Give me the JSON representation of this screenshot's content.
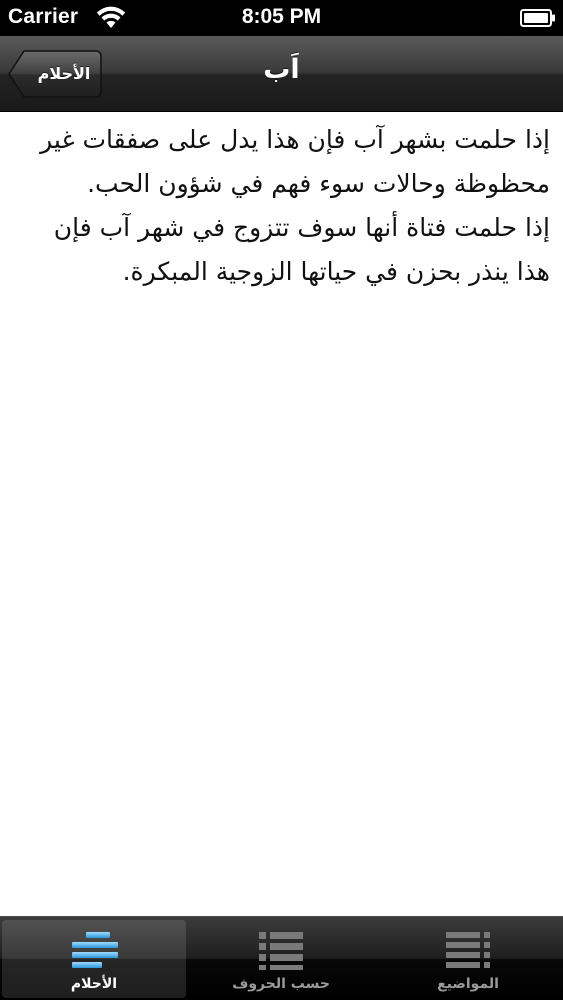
{
  "status_bar": {
    "carrier": "Carrier",
    "time": "8:05 PM",
    "wifi_icon": "wifi-icon",
    "battery_icon": "battery-icon"
  },
  "nav_bar": {
    "title": "اَب",
    "back_label": "الأحلام"
  },
  "content": {
    "paragraphs": [
      "إذا حلمت بشهر آب فإن هذا يدل على صفقات غير محظوظة وحالات سوء فهم في شؤون الحب.",
      "إذا حلمت فتاة أنها سوف تتزوج في شهر آب فإن هذا ينذر بحزن في حياتها الزوجية المبكرة."
    ]
  },
  "tab_bar": {
    "tabs": [
      {
        "label": "المواضيع",
        "icon": "list-icon",
        "selected": false
      },
      {
        "label": "حسب الحروف",
        "icon": "bulleted-list-icon",
        "selected": false
      },
      {
        "label": "الأحلام",
        "icon": "lines-icon",
        "selected": true
      }
    ],
    "selected_color": "#4fb3e8"
  }
}
